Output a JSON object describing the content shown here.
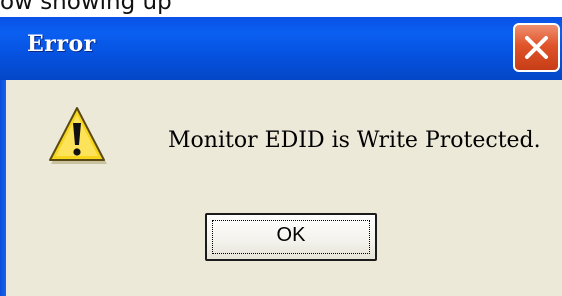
{
  "background": {
    "caption": "ow showing up\""
  },
  "dialog": {
    "title": "Error",
    "message": "Monitor EDID is Write Protected.",
    "icon": "warning-icon",
    "close_icon": "close-icon",
    "ok_label": "OK"
  },
  "colors": {
    "titlebar": "#0550dd",
    "window_face": "#ece9d8",
    "close_button": "#e0542a",
    "warning_yellow": "#f7d51c"
  }
}
